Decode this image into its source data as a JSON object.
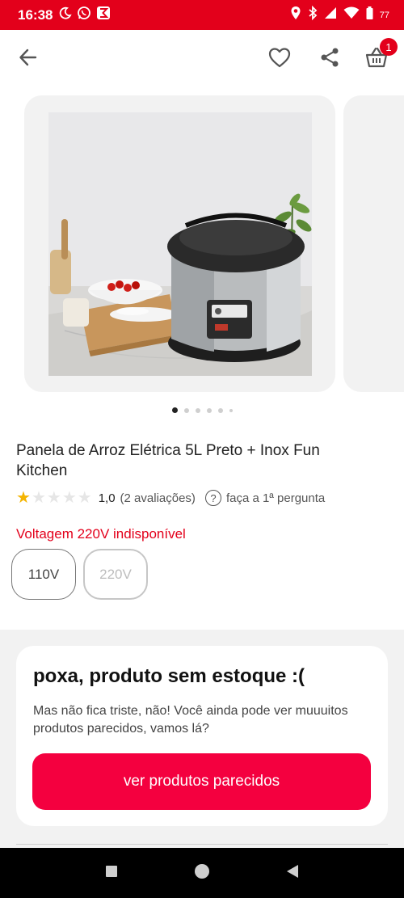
{
  "status_bar": {
    "time": "16:38",
    "left_icons": [
      "moon-icon",
      "whatsapp-icon",
      "sum-app-icon"
    ],
    "right_icons": [
      "location-icon",
      "bluetooth-icon",
      "signal-icon",
      "wifi-icon",
      "battery-icon"
    ],
    "battery": "77"
  },
  "header": {
    "back_icon": "arrow-left-icon",
    "favorite_icon": "heart-icon",
    "share_icon": "share-icon",
    "cart_icon": "basket-icon",
    "cart_count": "1"
  },
  "gallery": {
    "image_alt": "rice cooker product photo",
    "dot_count": 6,
    "active_index": 0
  },
  "product": {
    "title": "Panela de Arroz Elétrica 5L Preto + Inox Fun Kitchen",
    "rating_value": "1,0",
    "rating_count": "(2 avaliações)",
    "stars_filled": 1,
    "stars_total": 5,
    "question_link": "faça a 1ª pergunta"
  },
  "voltage": {
    "message": "Voltagem 220V indisponível",
    "options": [
      {
        "label": "110V",
        "available": true
      },
      {
        "label": "220V",
        "available": false
      }
    ]
  },
  "out_of_stock": {
    "title": "poxa, produto sem estoque :(",
    "description": "Mas não fica triste, não! Você ainda pode ver muuuitos produtos parecidos, vamos lá?",
    "button_label": "ver produtos parecidos"
  },
  "colors": {
    "brand_red": "#e3001b",
    "button_red": "#f4003f",
    "star_yellow": "#f4b400"
  },
  "nav_bar": {
    "icons": [
      "recents-square-icon",
      "home-circle-icon",
      "back-triangle-icon"
    ]
  }
}
